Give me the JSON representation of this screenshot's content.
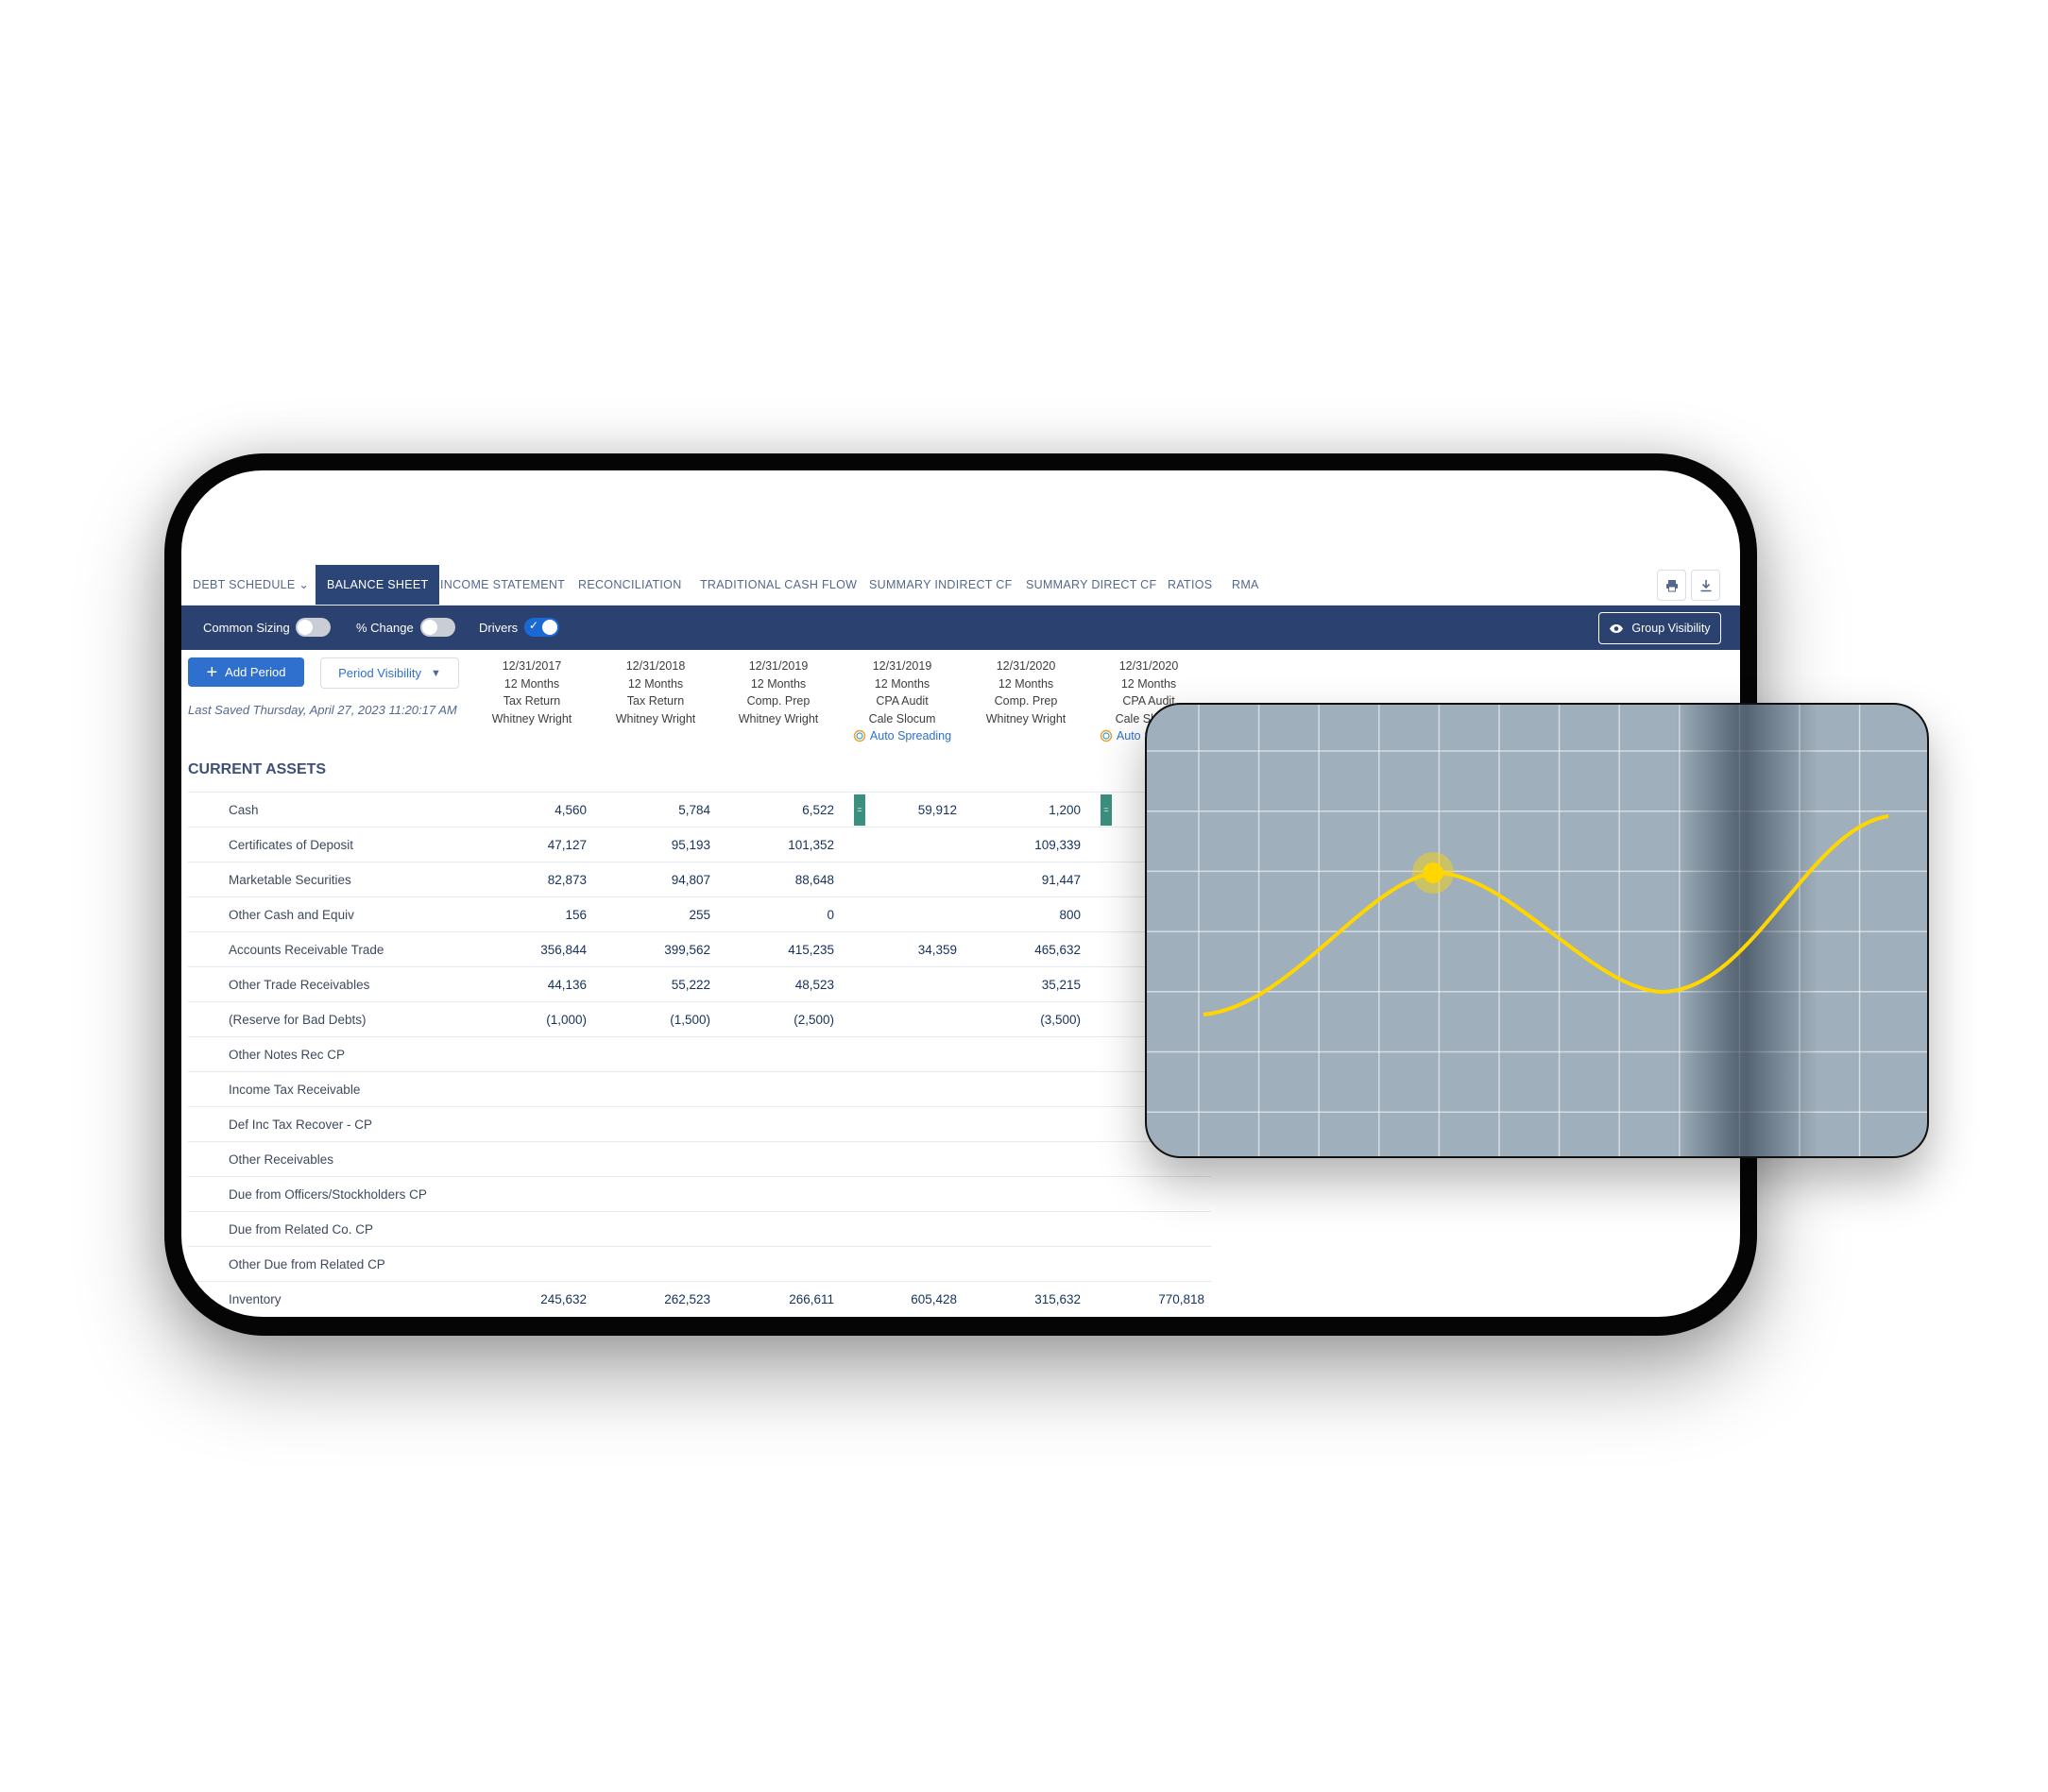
{
  "tabs": [
    {
      "label": "DEBT SCHEDULE",
      "has_dropdown": true
    },
    {
      "label": "BALANCE SHEET",
      "active": true
    },
    {
      "label": "INCOME STATEMENT"
    },
    {
      "label": "RECONCILIATION"
    },
    {
      "label": "TRADITIONAL CASH FLOW"
    },
    {
      "label": "SUMMARY INDIRECT CF"
    },
    {
      "label": "SUMMARY DIRECT CF"
    },
    {
      "label": "RATIOS"
    },
    {
      "label": "RMA"
    }
  ],
  "tab_icons": [
    "printer-icon",
    "download-icon"
  ],
  "toolbar": {
    "common_sizing": {
      "label": "Common Sizing",
      "on": false
    },
    "pct_change": {
      "label": "% Change",
      "on": false
    },
    "drivers": {
      "label": "Drivers",
      "on": true
    },
    "group_visibility": "Group Visibility"
  },
  "actions": {
    "add_period": "Add Period",
    "period_visibility": "Period Visibility",
    "last_saved": "Last Saved Thursday, April 27, 2023 11:20:17 AM"
  },
  "periods": [
    {
      "date": "12/31/2017",
      "duration": "12 Months",
      "type": "Tax Return",
      "preparer": "Whitney Wright",
      "auto": ""
    },
    {
      "date": "12/31/2018",
      "duration": "12 Months",
      "type": "Tax Return",
      "preparer": "Whitney Wright",
      "auto": ""
    },
    {
      "date": "12/31/2019",
      "duration": "12 Months",
      "type": "Comp. Prep",
      "preparer": "Whitney Wright",
      "auto": ""
    },
    {
      "date": "12/31/2019",
      "duration": "12 Months",
      "type": "CPA Audit",
      "preparer": "Cale Slocum",
      "auto": "Auto Spreading"
    },
    {
      "date": "12/31/2020",
      "duration": "12 Months",
      "type": "Comp. Prep",
      "preparer": "Whitney Wright",
      "auto": ""
    },
    {
      "date": "12/31/2020",
      "duration": "12 Months",
      "type": "CPA Audit",
      "preparer": "Cale Slocum",
      "auto": "Auto Spreading"
    }
  ],
  "section_title": "CURRENT ASSETS",
  "rows": [
    {
      "label": "Cash",
      "values": [
        "4,560",
        "5,784",
        "6,522",
        "59,912",
        "1,200",
        ""
      ],
      "markers": "="
    },
    {
      "label": "Certificates of Deposit",
      "values": [
        "47,127",
        "95,193",
        "101,352",
        "",
        "109,339",
        ""
      ]
    },
    {
      "label": "Marketable Securities",
      "values": [
        "82,873",
        "94,807",
        "88,648",
        "",
        "91,447",
        ""
      ]
    },
    {
      "label": "Other Cash and Equiv",
      "values": [
        "156",
        "255",
        "0",
        "",
        "800",
        ""
      ]
    },
    {
      "label": "Accounts Receivable Trade",
      "values": [
        "356,844",
        "399,562",
        "415,235",
        "34,359",
        "465,632",
        ""
      ]
    },
    {
      "label": "Other Trade Receivables",
      "values": [
        "44,136",
        "55,222",
        "48,523",
        "",
        "35,215",
        ""
      ]
    },
    {
      "label": "(Reserve for Bad Debts)",
      "values": [
        "(1,000)",
        "(1,500)",
        "(2,500)",
        "",
        "(3,500)",
        ""
      ]
    },
    {
      "label": "Other Notes Rec CP",
      "values": [
        "",
        "",
        "",
        "",
        "",
        ""
      ]
    },
    {
      "label": "Income Tax Receivable",
      "values": [
        "",
        "",
        "",
        "",
        "",
        ""
      ]
    },
    {
      "label": "Def Inc Tax Recover - CP",
      "values": [
        "",
        "",
        "",
        "",
        "",
        ""
      ]
    },
    {
      "label": "Other Receivables",
      "values": [
        "",
        "",
        "",
        "",
        "",
        ""
      ]
    },
    {
      "label": "Due from Officers/Stockholders CP",
      "values": [
        "",
        "",
        "",
        "",
        "",
        ""
      ]
    },
    {
      "label": "Due from Related Co. CP",
      "values": [
        "",
        "",
        "",
        "",
        "",
        ""
      ]
    },
    {
      "label": "Other Due from Related CP",
      "values": [
        "",
        "",
        "",
        "",
        "",
        ""
      ]
    },
    {
      "label": "Inventory",
      "values": [
        "245,632",
        "262,523",
        "266,611",
        "605,428",
        "315,632",
        "770,818"
      ]
    }
  ],
  "colors": {
    "nav_bar": "#2b4170",
    "active_tab": "#2b4676",
    "primary_button": "#2f6fce",
    "marker": "#3b8f7f",
    "overlay_card": "#a0afbc",
    "curve": "#ffd600"
  }
}
